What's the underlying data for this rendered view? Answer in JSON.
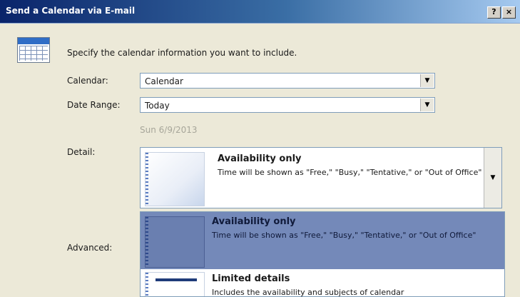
{
  "window": {
    "title": "Send a Calendar via E-mail",
    "help_label": "?",
    "close_label": "×"
  },
  "intro": "Specify the calendar information you want to include.",
  "form": {
    "calendar_label": "Calendar:",
    "calendar_value": "Calendar",
    "date_range_label": "Date Range:",
    "date_range_value": "Today",
    "date_hint": "Sun 6/9/2013",
    "detail_label": "Detail:",
    "advanced_label": "Advanced:"
  },
  "detail": {
    "selected_title": "Availability only",
    "selected_desc": "Time will be shown as \"Free,\" \"Busy,\" \"Tentative,\" or \"Out of Office\""
  },
  "dropdown": {
    "items": [
      {
        "title": "Availability only",
        "desc": "Time will be shown as \"Free,\" \"Busy,\" \"Tentative,\" or \"Out of Office\""
      },
      {
        "title": "Limited details",
        "desc": "Includes the availability and subjects of calendar"
      }
    ]
  },
  "colors": {
    "titlebar": "#0a246a",
    "highlight": "#7489b9",
    "dialog_bg": "#ece9d8"
  },
  "icons": {
    "calendar": "calendar-icon",
    "dropdown_arrow": "chevron-down-icon"
  }
}
